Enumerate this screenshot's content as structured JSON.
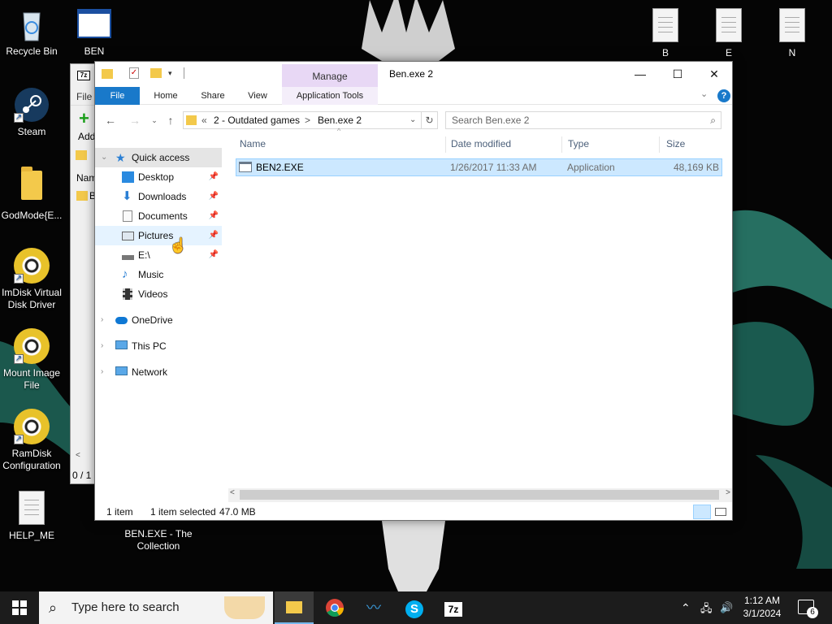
{
  "desktop": {
    "icons": {
      "recycle_bin": "Recycle Bin",
      "ben": "BEN",
      "steam": "Steam",
      "godmode": "GodMode{E...",
      "imdisk": "ImDisk Virtual Disk Driver",
      "mount_image": "Mount Image File",
      "ramdisk": "RamDisk Configuration",
      "help_me": "HELP_ME",
      "ben_collection": "BEN.EXE - The Collection",
      "file_b": "B",
      "file_e": "E",
      "file_n": "N"
    },
    "bg_window_7z": {
      "menu_file": "File",
      "add_label": "Add",
      "name_col": "Nam",
      "row_b": "B",
      "status": "0 / 1 o"
    }
  },
  "explorer": {
    "title": "Ben.exe 2",
    "manage_tab": "Manage",
    "ribbon_tabs": {
      "file": "File",
      "home": "Home",
      "share": "Share",
      "view": "View",
      "app_tools": "Application Tools"
    },
    "address": {
      "overflow": "«",
      "crumb1": "2 - Outdated games",
      "sep": ">",
      "crumb2": "Ben.exe 2"
    },
    "search_placeholder": "Search Ben.exe 2",
    "nav": {
      "quick_access": "Quick access",
      "desktop": "Desktop",
      "downloads": "Downloads",
      "documents": "Documents",
      "pictures": "Pictures",
      "e_drive": "E:\\",
      "music": "Music",
      "videos": "Videos",
      "onedrive": "OneDrive",
      "this_pc": "This PC",
      "network": "Network"
    },
    "columns": {
      "name": "Name",
      "date": "Date modified",
      "type": "Type",
      "size": "Size"
    },
    "file": {
      "name": "BEN2.EXE",
      "date": "1/26/2017 11:33 AM",
      "type": "Application",
      "size": "48,169 KB"
    },
    "status": {
      "count": "1 item",
      "selected": "1 item selected",
      "size": "47.0 MB"
    }
  },
  "taskbar": {
    "search_placeholder": "Type here to search",
    "time": "1:12 AM",
    "date": "3/1/2024",
    "notification_count": "6"
  },
  "colors": {
    "accent": "#1979ca",
    "manage_tab": "#e8d8f5",
    "selection": "#cce8ff",
    "taskbar": "#1c1c1c"
  }
}
